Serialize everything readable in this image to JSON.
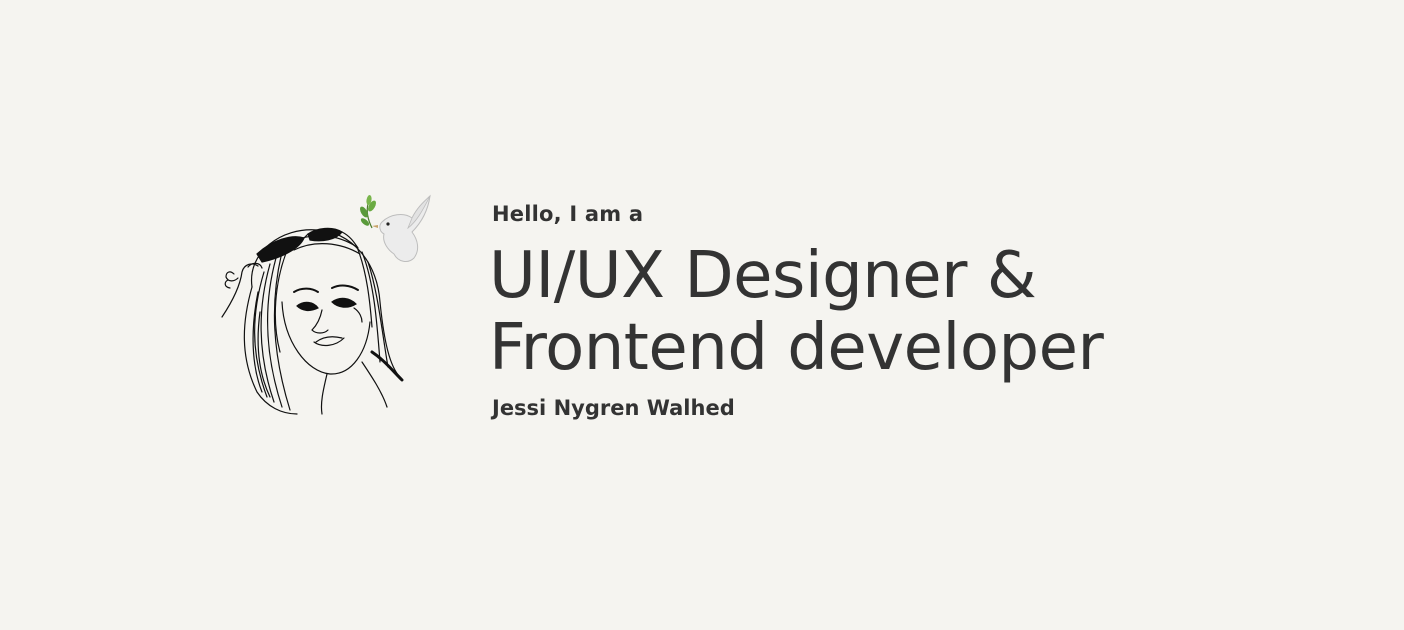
{
  "hero": {
    "greeting": "Hello, I am a",
    "headline_line1": "UI/UX Designer &",
    "headline_line2": "Frontend developer",
    "name": "Jessi Nygren Walhed"
  },
  "icons": {
    "portrait": "portrait-illustration-icon",
    "dove": "dove-with-olive-branch-icon"
  },
  "colors": {
    "background": "#f5f4f0",
    "text": "#333333",
    "leaf": "#5a9a3a"
  }
}
